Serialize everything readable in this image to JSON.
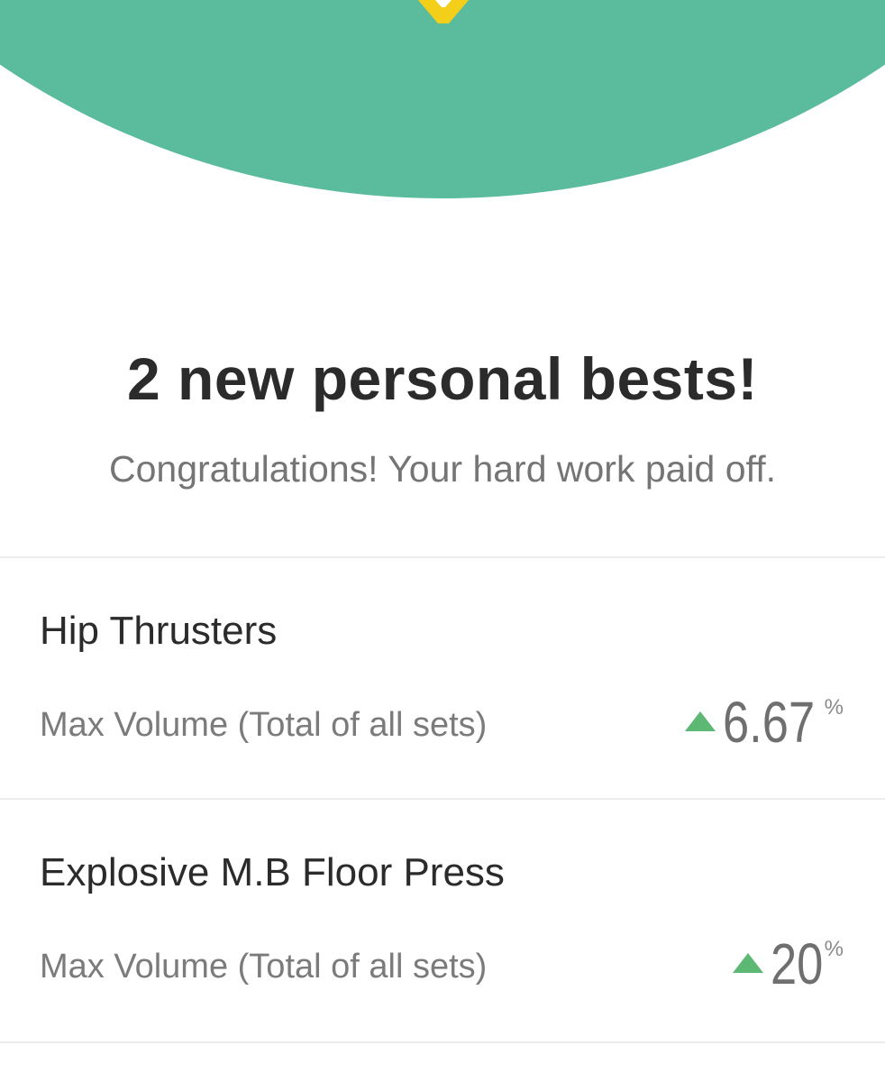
{
  "colors": {
    "hero_green": "#5bbb9d",
    "badge_yellow": "#f3cf1a",
    "up_arrow": "#5cb872"
  },
  "hero": {
    "icon": "badge-icon"
  },
  "summary": {
    "title": "2 new personal bests!",
    "subtitle": "Congratulations! Your hard work paid off."
  },
  "personal_bests": [
    {
      "exercise": "Hip Thrusters",
      "metric": "Max Volume (Total of all sets)",
      "change_value": "6.67",
      "change_unit": "%",
      "direction_icon": "up-arrow-icon"
    },
    {
      "exercise": "Explosive M.B Floor Press",
      "metric": "Max Volume (Total of all sets)",
      "change_value": "20",
      "change_unit": "%",
      "direction_icon": "up-arrow-icon"
    }
  ]
}
